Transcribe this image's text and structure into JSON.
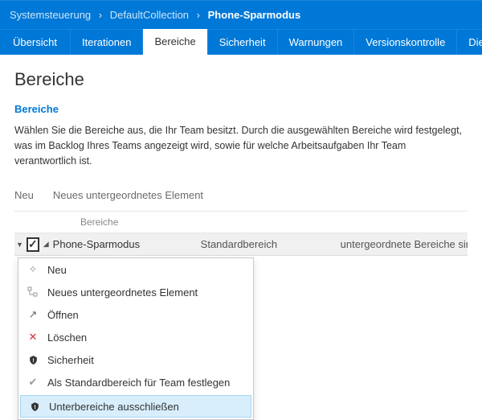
{
  "breadcrumb": {
    "part1": "Systemsteuerung",
    "part2": "DefaultCollection",
    "part3": "Phone-Sparmodus"
  },
  "tabs": {
    "overview": "Übersicht",
    "iterations": "Iterationen",
    "areas": "Bereiche",
    "security": "Sicherheit",
    "alerts": "Warnungen",
    "version": "Versionskontrolle",
    "services": "Dienst…"
  },
  "page": {
    "title": "Bereiche",
    "section": "Bereiche",
    "desc1": "Wählen Sie die Bereiche aus, die Ihr Team besitzt. Durch die ausgewählten Bereiche wird festgelegt,",
    "desc2": "was im Backlog Ihres Teams angezeigt wird, sowie für welche Arbeitsaufgaben Ihr Team verantwortlich ist."
  },
  "toolbar": {
    "new_label": "Neu",
    "child_label": "Neues untergeordnetes Element"
  },
  "grid": {
    "col_areas": "Bereiche",
    "row1_name": "Phone-Sparmodus",
    "row1_default": "Standardbereich",
    "row1_sub": "untergeordnete Bereiche sind eing…"
  },
  "menu": {
    "new": "Neu",
    "child": "Neues untergeordnetes Element",
    "open": "Öffnen",
    "delete": "Löschen",
    "security": "Sicherheit",
    "setdefault": "Als Standardbereich für Team festlegen",
    "exclude": "Unterbereiche ausschließen"
  }
}
